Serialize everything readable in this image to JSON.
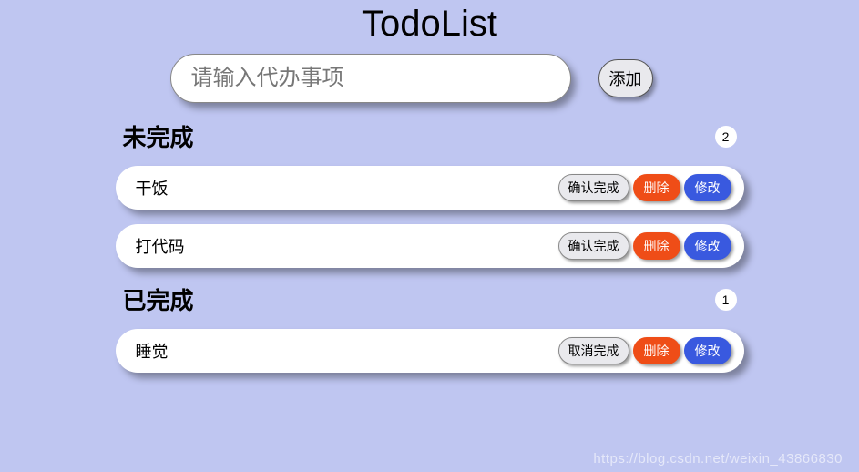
{
  "header": {
    "title": "TodoList"
  },
  "input": {
    "placeholder": "请输入代办事项",
    "add_label": "添加"
  },
  "sections": {
    "incomplete": {
      "title": "未完成",
      "count": "2"
    },
    "complete": {
      "title": "已完成",
      "count": "1"
    }
  },
  "items": {
    "incomplete": [
      {
        "text": "干饭"
      },
      {
        "text": "打代码"
      }
    ],
    "complete": [
      {
        "text": "睡觉"
      }
    ]
  },
  "buttons": {
    "confirm_done": "确认完成",
    "undo_done": "取消完成",
    "delete": "删除",
    "edit": "修改"
  },
  "watermark": "https://blog.csdn.net/weixin_43866830"
}
